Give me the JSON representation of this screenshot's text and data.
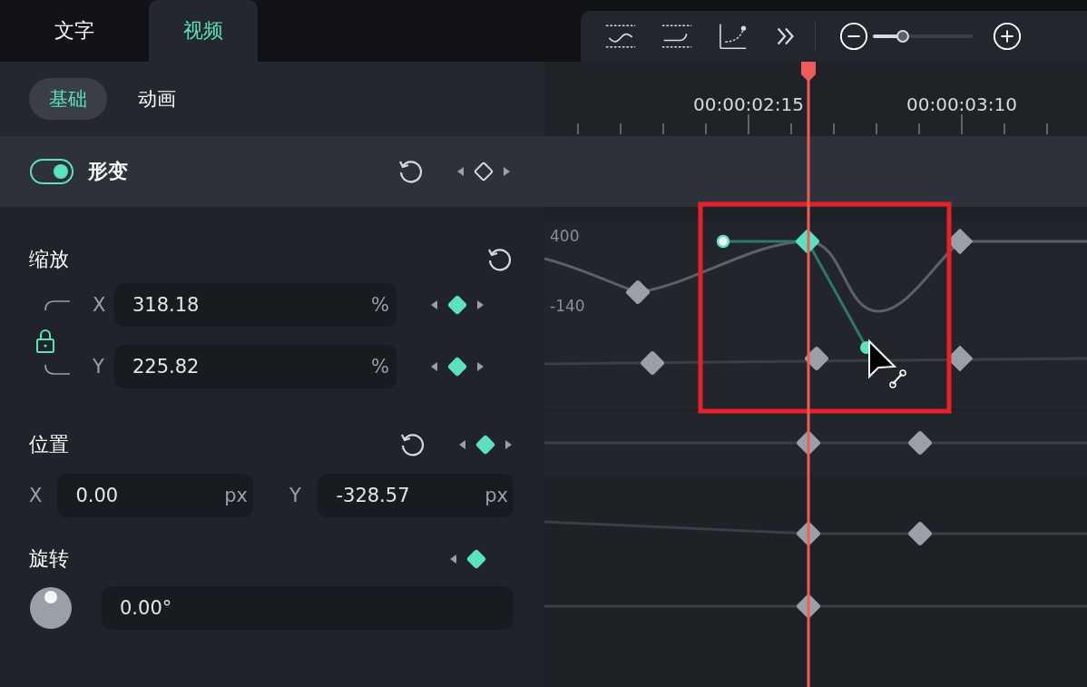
{
  "tabs": [
    {
      "label": "文字",
      "selected": false
    },
    {
      "label": "视频",
      "selected": true
    }
  ],
  "subtabs": [
    {
      "label": "基础",
      "selected": true
    },
    {
      "label": "动画",
      "selected": false
    }
  ],
  "section": {
    "title": "形变",
    "on": true,
    "keyframe_set": false
  },
  "scale": {
    "label": "缩放",
    "locked": true,
    "fields": [
      {
        "axis": "X",
        "value": "318.18",
        "unit": "%",
        "keyframe_set": true
      },
      {
        "axis": "Y",
        "value": "225.82",
        "unit": "%",
        "keyframe_set": true
      }
    ]
  },
  "position": {
    "label": "位置",
    "keyframe_set": true,
    "fields": [
      {
        "axis": "X",
        "value": "0.00",
        "unit": "px"
      },
      {
        "axis": "Y",
        "value": "-328.57",
        "unit": "px"
      }
    ]
  },
  "rotation": {
    "label": "旋转",
    "keyframe_set": true,
    "value": "0.00°"
  },
  "timeline": {
    "zoom": {
      "level": 0.3
    },
    "times": [
      "00:00:02:15",
      "00:00:03:10"
    ],
    "graph_labels": [
      "400",
      "-140"
    ]
  }
}
